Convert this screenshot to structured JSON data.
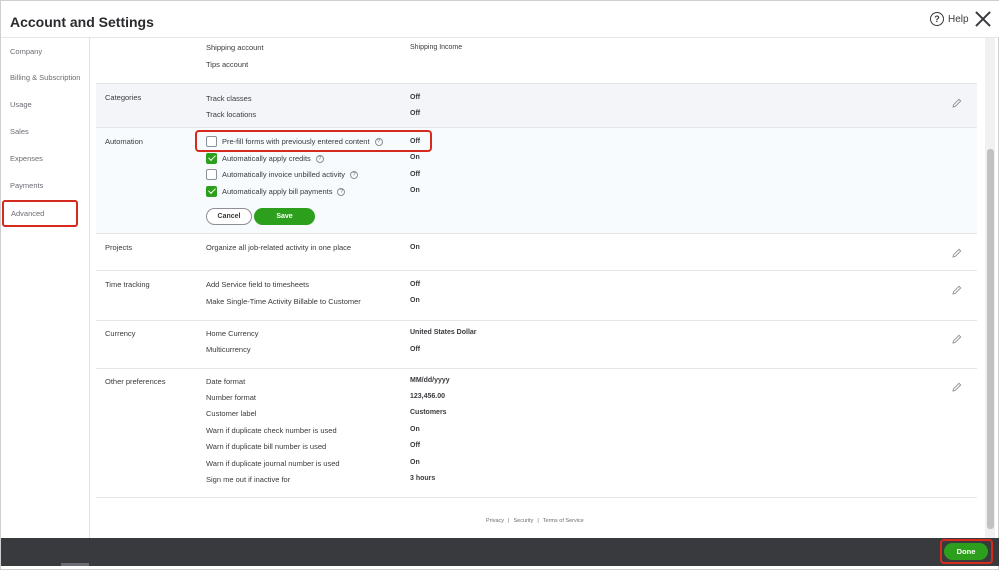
{
  "header": {
    "title": "Account and Settings",
    "help_label": "Help"
  },
  "sidebar": {
    "items": [
      {
        "label": "Company"
      },
      {
        "label": "Billing & Subscription"
      },
      {
        "label": "Usage"
      },
      {
        "label": "Sales"
      },
      {
        "label": "Expenses"
      },
      {
        "label": "Payments"
      },
      {
        "label": "Advanced"
      }
    ]
  },
  "sections": {
    "shipping": {
      "rows": [
        {
          "label": "Shipping account",
          "value": "Shipping Income"
        },
        {
          "label": "Tips account",
          "value": ""
        }
      ]
    },
    "categories": {
      "label": "Categories",
      "rows": [
        {
          "label": "Track classes",
          "value": "Off"
        },
        {
          "label": "Track locations",
          "value": "Off"
        }
      ]
    },
    "automation": {
      "label": "Automation",
      "rows": [
        {
          "label": "Pre-fill forms with previously entered content",
          "value": "Off",
          "checked": false
        },
        {
          "label": "Automatically apply credits",
          "value": "On",
          "checked": true
        },
        {
          "label": "Automatically invoice unbilled activity",
          "value": "Off",
          "checked": false
        },
        {
          "label": "Automatically apply bill payments",
          "value": "On",
          "checked": true
        }
      ],
      "cancel_label": "Cancel",
      "save_label": "Save"
    },
    "projects": {
      "label": "Projects",
      "rows": [
        {
          "label": "Organize all job-related activity in one place",
          "value": "On"
        }
      ]
    },
    "time_tracking": {
      "label": "Time tracking",
      "rows": [
        {
          "label": "Add Service field to timesheets",
          "value": "Off"
        },
        {
          "label": "Make Single-Time Activity Billable to Customer",
          "value": "On"
        }
      ]
    },
    "currency": {
      "label": "Currency",
      "rows": [
        {
          "label": "Home Currency",
          "value": "United States Dollar"
        },
        {
          "label": "Multicurrency",
          "value": "Off"
        }
      ]
    },
    "other": {
      "label": "Other preferences",
      "rows": [
        {
          "label": "Date format",
          "value": "MM/dd/yyyy"
        },
        {
          "label": "Number format",
          "value": "123,456.00"
        },
        {
          "label": "Customer label",
          "value": "Customers"
        },
        {
          "label": "Warn if duplicate check number is used",
          "value": "On"
        },
        {
          "label": "Warn if duplicate bill number is used",
          "value": "Off"
        },
        {
          "label": "Warn if duplicate journal number is used",
          "value": "On"
        },
        {
          "label": "Sign me out if inactive for",
          "value": "3 hours"
        }
      ]
    }
  },
  "footer": {
    "privacy": "Privacy",
    "security": "Security",
    "terms": "Terms of Service",
    "separator": "|"
  },
  "bottom_bar": {
    "done_label": "Done"
  },
  "colors": {
    "accent_green": "#2ca01c",
    "highlight_red": "#d52b1e",
    "bottom_bar": "#393a3d"
  },
  "icons": [
    "help-icon",
    "close-icon",
    "edit-pencil-icon",
    "info-icon",
    "checkmark-icon"
  ]
}
